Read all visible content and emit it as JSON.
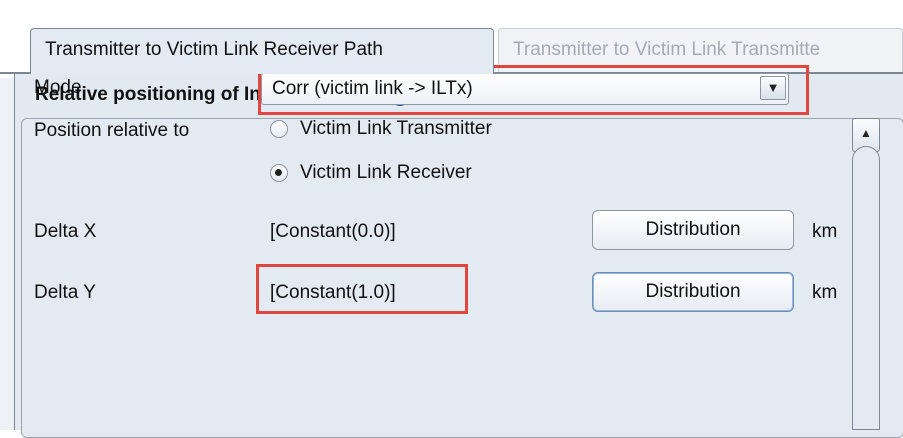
{
  "tabs": [
    {
      "label": "Transmitter to Victim Link Receiver Path",
      "active": true
    },
    {
      "label": "Transmitter to Victim Link Transmitte",
      "active": false
    }
  ],
  "section": {
    "title": "Relative positioning of Interfering Link",
    "help_icon": "help-icon"
  },
  "form": {
    "mode_label": "Mode",
    "mode_value": "Corr (victim link -> ILTx)",
    "position_label": "Position relative to",
    "position_options": [
      {
        "label": "Victim Link Transmitter",
        "checked": false
      },
      {
        "label": "Victim Link Receiver",
        "checked": true
      }
    ],
    "delta_x": {
      "label": "Delta X",
      "value": "[Constant(0.0)]",
      "button": "Distribution",
      "unit": "km"
    },
    "delta_y": {
      "label": "Delta Y",
      "value": "[Constant(1.0)]",
      "button": "Distribution",
      "unit": "km"
    }
  },
  "colors": {
    "highlight": "#e2473f",
    "panel": "#e3e9f1",
    "border": "#7c8796"
  }
}
